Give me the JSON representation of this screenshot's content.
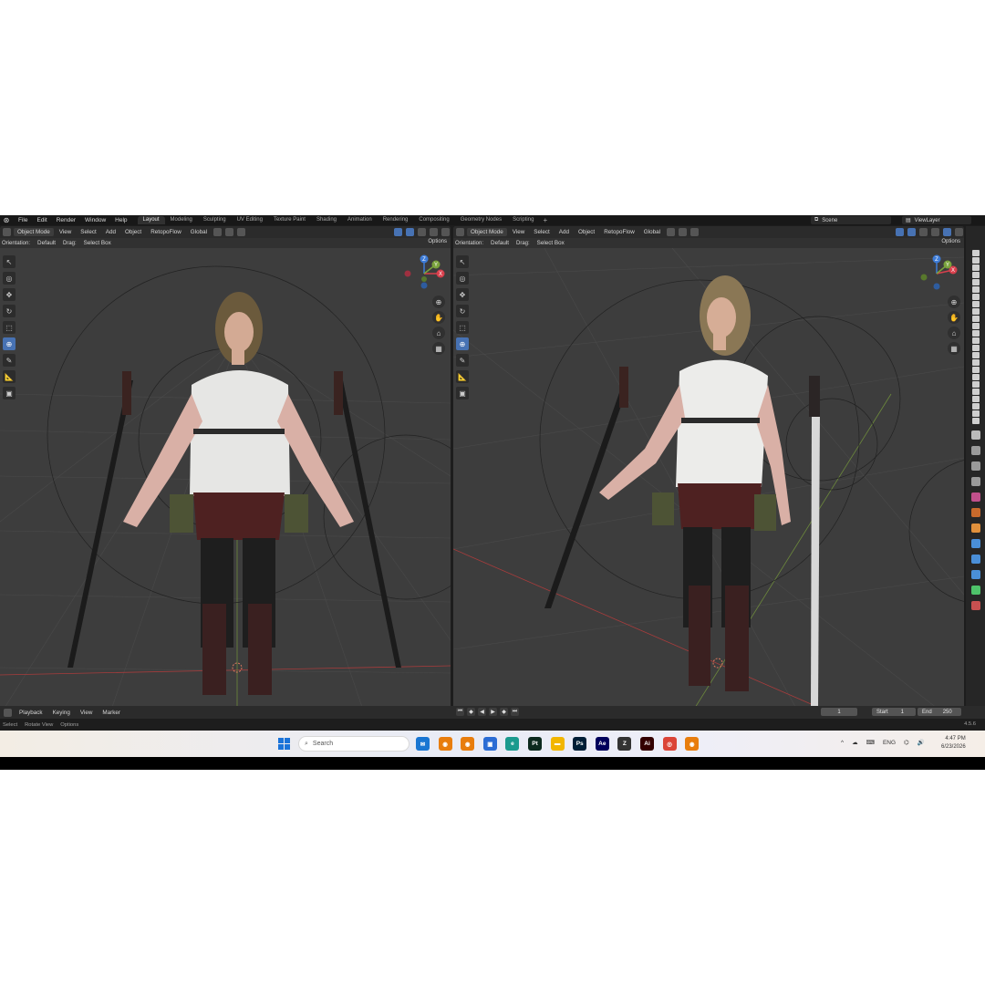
{
  "topbar": {
    "menu": [
      "File",
      "Edit",
      "Render",
      "Window",
      "Help"
    ],
    "workspaces": [
      "Layout",
      "Modeling",
      "Sculpting",
      "UV Editing",
      "Texture Paint",
      "Shading",
      "Animation",
      "Rendering",
      "Compositing",
      "Geometry Nodes",
      "Scripting"
    ],
    "active_workspace": "Layout",
    "add_tab": "+",
    "scene": "Scene",
    "view_layer": "ViewLayer"
  },
  "viewport_header": {
    "mode": "Object Mode",
    "menus": [
      "View",
      "Select",
      "Add",
      "Object"
    ],
    "addon": "RetopoFlow",
    "transform": "Global",
    "orientation_label": "Orientation:",
    "orientation_value": "Default",
    "drag_label": "Drag:",
    "drag_value": "Select Box",
    "options": "Options"
  },
  "gizmo": {
    "x": "X",
    "y": "Y",
    "z": "Z"
  },
  "timeline": {
    "menus": [
      "Playback",
      "Keying",
      "View",
      "Marker"
    ],
    "current_frame": "1",
    "start_label": "Start",
    "start": "1",
    "end_label": "End",
    "end": "250"
  },
  "statusbar": {
    "hints": [
      "Select",
      "Rotate View",
      "Options"
    ],
    "version": "4.5.6"
  },
  "taskbar": {
    "search_placeholder": "Search",
    "apps": [
      {
        "name": "mail",
        "label": "✉",
        "color": "#1976d2"
      },
      {
        "name": "blender-1",
        "label": "◉",
        "color": "#e87d0d"
      },
      {
        "name": "blender-2",
        "label": "◉",
        "color": "#e87d0d"
      },
      {
        "name": "store",
        "label": "▣",
        "color": "#2b6cd4"
      },
      {
        "name": "edge",
        "label": "e",
        "color": "#1b9a8e"
      },
      {
        "name": "pt",
        "label": "Pt",
        "color": "#0c2a1e"
      },
      {
        "name": "files",
        "label": "▬",
        "color": "#f2b600"
      },
      {
        "name": "ps",
        "label": "Ps",
        "color": "#001e36"
      },
      {
        "name": "ae",
        "label": "Ae",
        "color": "#00005b"
      },
      {
        "name": "zbrush",
        "label": "Z",
        "color": "#333333"
      },
      {
        "name": "ai",
        "label": "Ai",
        "color": "#330000"
      },
      {
        "name": "chrome",
        "label": "◎",
        "color": "#db4437"
      },
      {
        "name": "blender-3",
        "label": "◉",
        "color": "#e87d0d"
      }
    ],
    "tray_caret": "^",
    "lang": "ENG",
    "time": "4:47 PM",
    "date": "6/23/2026"
  }
}
